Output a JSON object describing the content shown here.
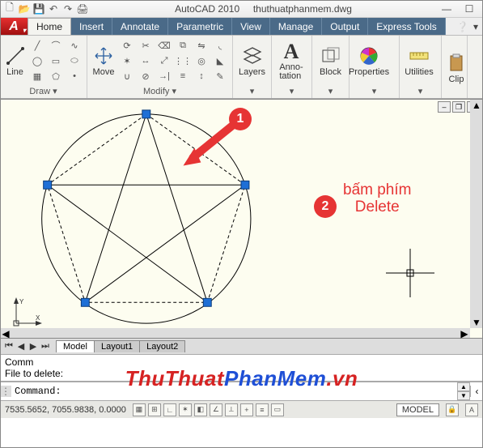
{
  "title": {
    "app": "AutoCAD 2010",
    "file": "thuthuatphanmem.dwg"
  },
  "tabs": {
    "items": [
      "Home",
      "Insert",
      "Annotate",
      "Parametric",
      "View",
      "Manage",
      "Output",
      "Express Tools"
    ],
    "active_index": 0
  },
  "ribbon": {
    "draw": {
      "label": "Draw ▾",
      "line": "Line"
    },
    "modify": {
      "label": "Modify ▾",
      "move": "Move"
    },
    "layers": {
      "label": "Layers",
      "btn": "Layers"
    },
    "annotation": {
      "label": "Anno-\ntation",
      "panel": "▾"
    },
    "block": {
      "label": "Block",
      "panel": "▾"
    },
    "properties": {
      "label": "Properties",
      "panel": "▾"
    },
    "utilities": {
      "label": "Utilities",
      "panel": "▾"
    },
    "clip": {
      "label": "Clip"
    }
  },
  "annotations": {
    "badge1": "1",
    "badge2": "2",
    "text2": "bấm phím\nDelete"
  },
  "layout_tabs": {
    "nav": [
      "⏮",
      "◀",
      "▶",
      "⏭"
    ],
    "items": [
      "Model",
      "Layout1",
      "Layout2"
    ],
    "active": 0
  },
  "command": {
    "line1": "Comm",
    "line2": "File to delete:",
    "prompt": "Command:"
  },
  "status": {
    "coords": "7535.5652, 7055.9838, 0.0000",
    "model": "MODEL"
  },
  "watermark": {
    "part1": "ThuThuat",
    "part2": "PhanMem",
    "part3": ".vn"
  }
}
